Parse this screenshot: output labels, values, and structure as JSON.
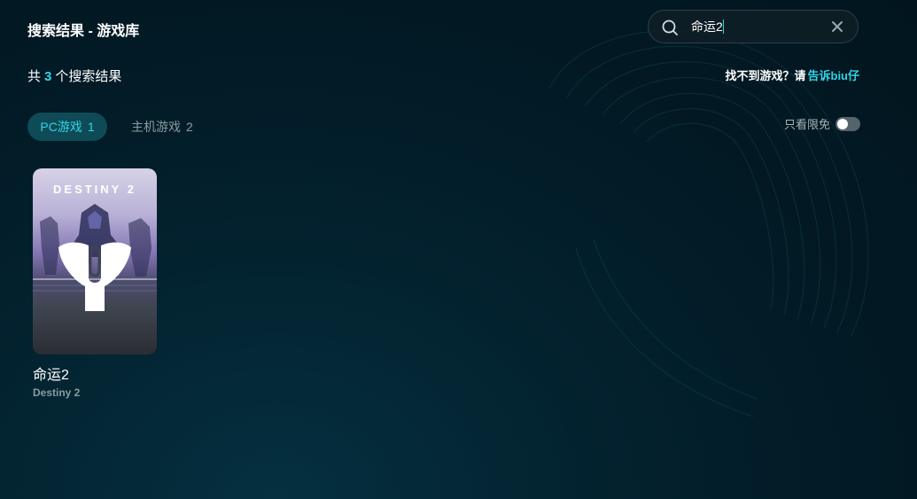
{
  "header": {
    "title": "搜索结果 - 游戏库"
  },
  "search": {
    "value": "命运2",
    "icon": "search-icon",
    "clear_icon": "close-icon"
  },
  "results": {
    "prefix": "共",
    "count": "3",
    "suffix": "个搜索结果"
  },
  "feedback": {
    "text": "找不到游戏？请",
    "link": "告诉biu仔"
  },
  "tabs": [
    {
      "label": "PC游戏",
      "count": "1",
      "active": true
    },
    {
      "label": "主机游戏",
      "count": "2",
      "active": false
    }
  ],
  "filter": {
    "free_only_label": "只看限免",
    "free_only_on": false
  },
  "games": [
    {
      "name": "命运2",
      "subtitle": "Destiny 2",
      "cover_logo": "DESTINY 2"
    }
  ],
  "colors": {
    "accent": "#2fd5e8",
    "background": "#02151e",
    "tab_active_bg": "#0f4a57",
    "muted_text": "#8a9ba2"
  }
}
